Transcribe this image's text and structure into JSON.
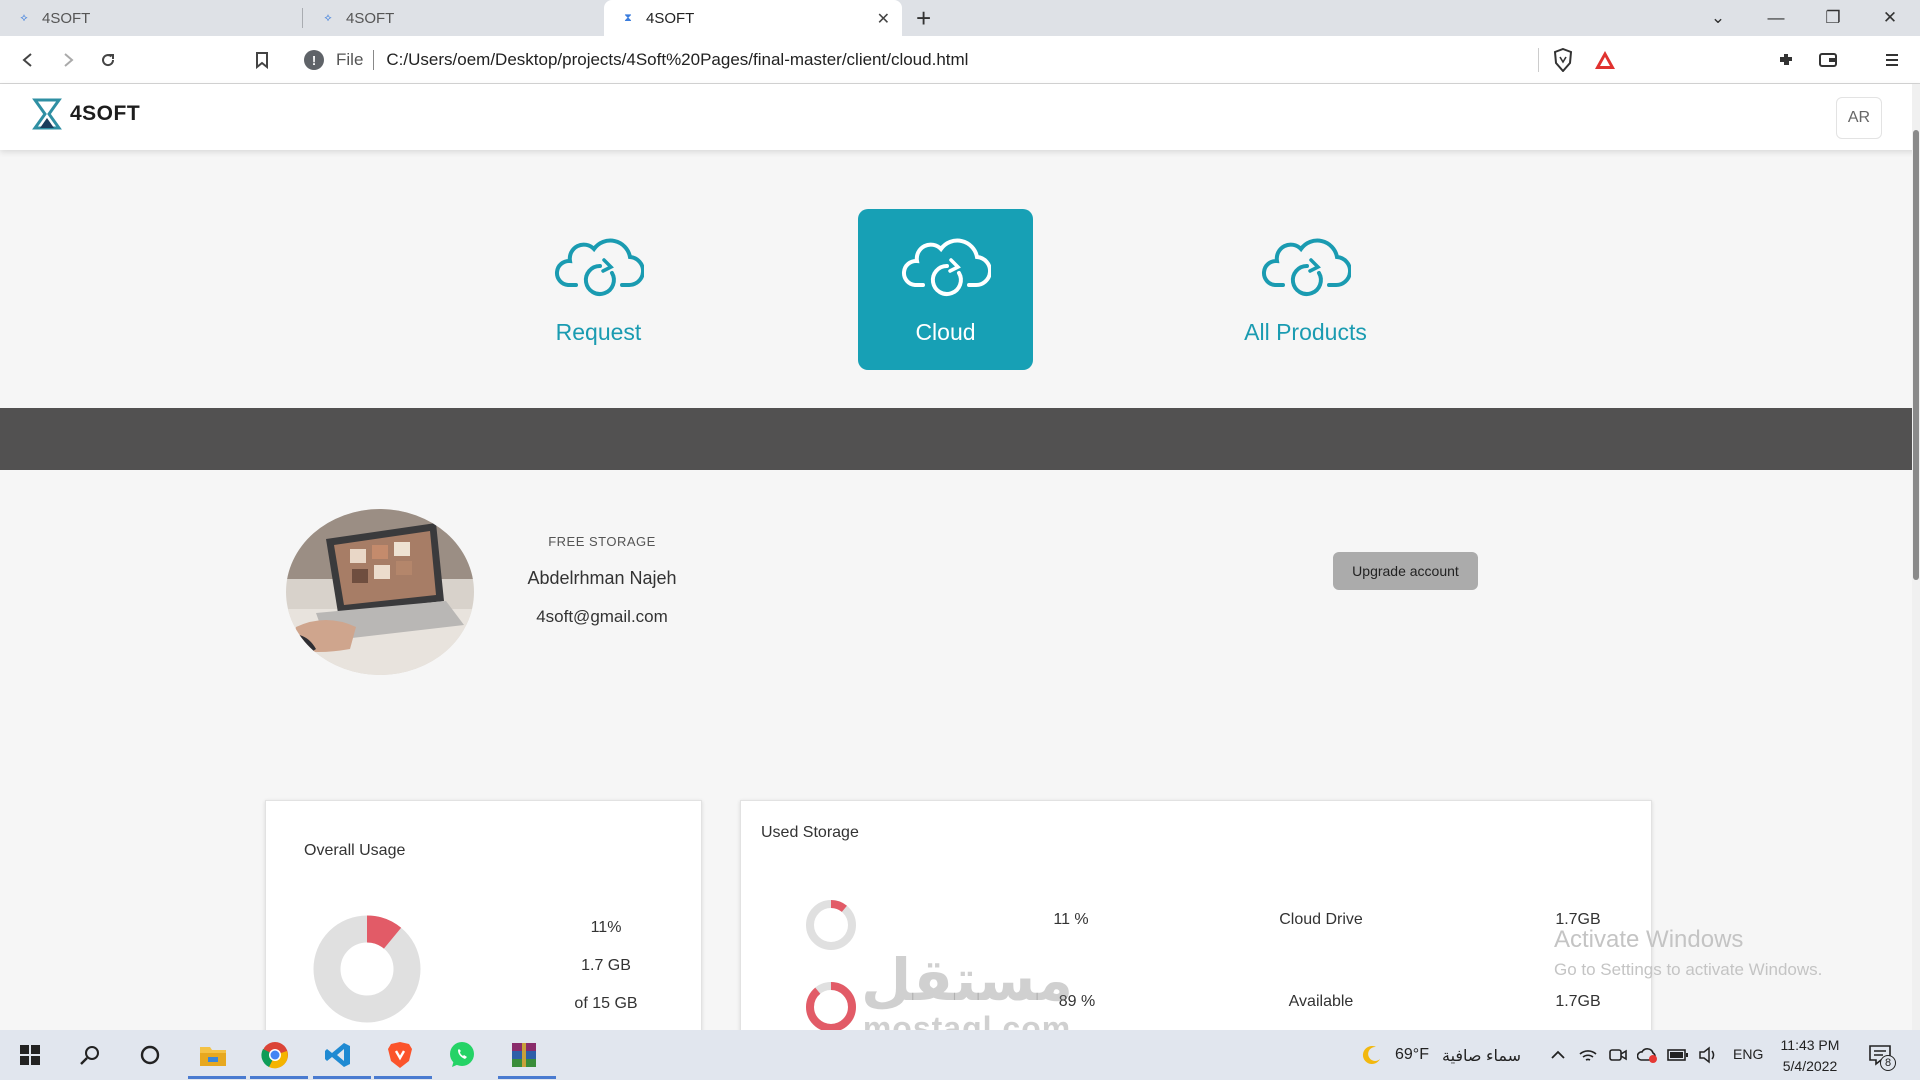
{
  "browser": {
    "tabs": [
      {
        "title": "4SOFT"
      },
      {
        "title": "4SOFT"
      },
      {
        "title": "4SOFT"
      }
    ],
    "address": {
      "protocol": "File",
      "url": "C:/Users/oem/Desktop/projects/4Soft%20Pages/final-master/client/cloud.html"
    }
  },
  "header": {
    "logo_text": "4SOFT",
    "lang_button": "AR"
  },
  "services": [
    {
      "label": "Request",
      "active": false
    },
    {
      "label": "Cloud",
      "active": true
    },
    {
      "label": "All Products",
      "active": false
    }
  ],
  "profile": {
    "plan": "FREE STORAGE",
    "name": "Abdelrhman Najeh",
    "email": "4soft@gmail.com",
    "upgrade_label": "Upgrade account"
  },
  "overall_usage": {
    "title": "Overall Usage",
    "percent": "11%",
    "used": "1.7 GB",
    "total": "of 15 GB",
    "fraction": 0.11
  },
  "used_storage": {
    "title": "Used Storage",
    "rows": [
      {
        "percent": "11 %",
        "label": "Cloud Drive",
        "size": "1.7GB",
        "fraction": 0.11
      },
      {
        "percent": "89 %",
        "label": "Available",
        "size": "1.7GB",
        "fraction": 0.89
      }
    ]
  },
  "activation": {
    "title": "Activate Windows",
    "subtitle": "Go to Settings to activate Windows."
  },
  "watermark": {
    "logo": "مستقل",
    "text": "mostaql.com"
  },
  "taskbar": {
    "weather": "69°F",
    "weather_desc": "سماء صافية",
    "language": "ENG",
    "time": "11:43 PM",
    "date": "5/4/2022",
    "notifications": "8"
  },
  "colors": {
    "accent": "#17a0b5",
    "donut_used": "#e25b67",
    "donut_track": "#e0e0e0",
    "band": "#525151"
  }
}
